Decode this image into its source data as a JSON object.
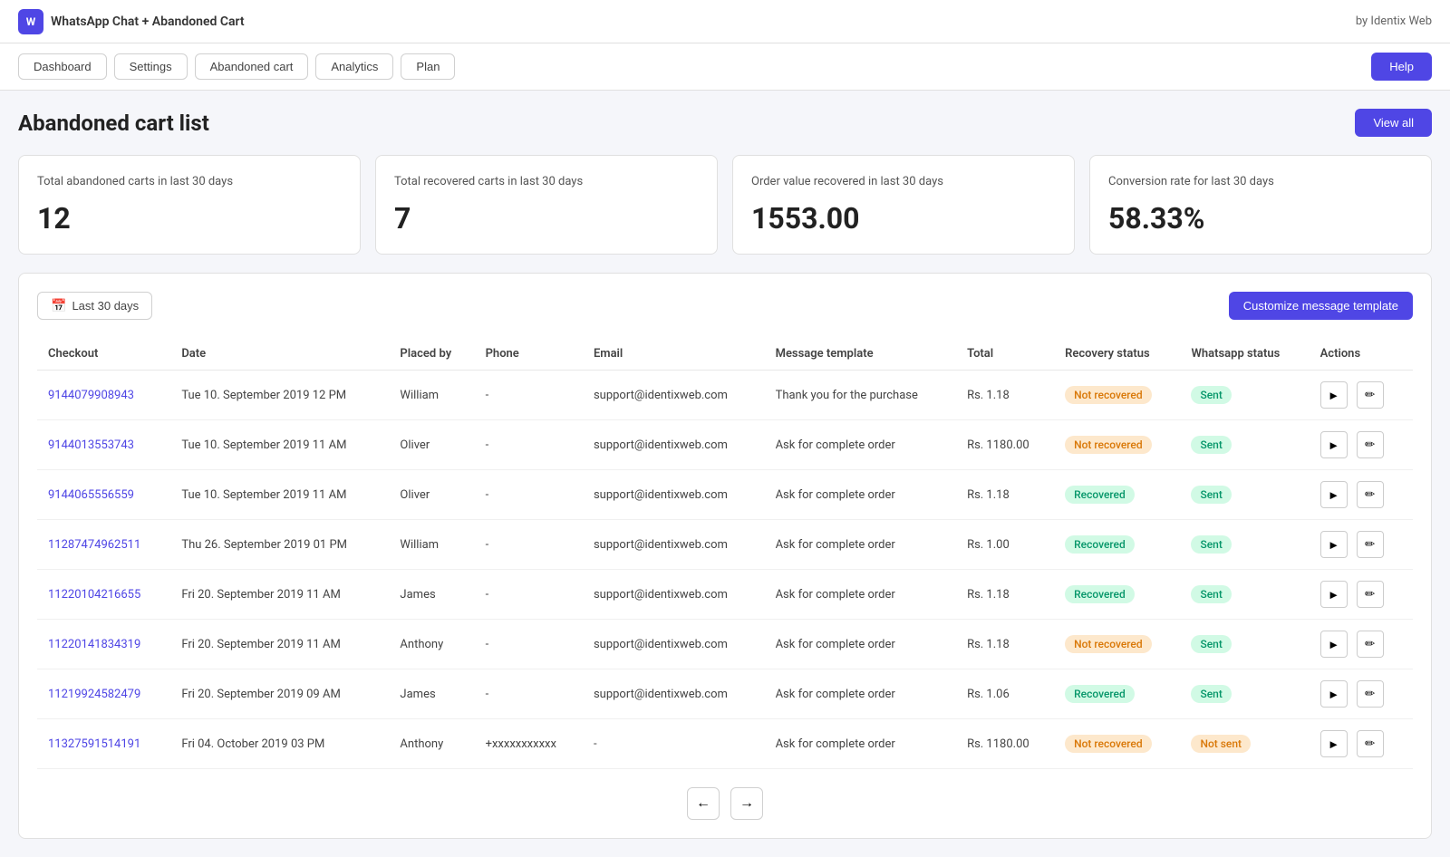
{
  "app": {
    "title": "WhatsApp Chat + Abandoned Cart",
    "brand": "by Identix Web",
    "icon_text": "W"
  },
  "nav": {
    "items": [
      "Dashboard",
      "Settings",
      "Abandoned cart",
      "Analytics",
      "Plan"
    ],
    "help_label": "Help"
  },
  "page": {
    "title": "Abandoned cart list",
    "view_all_label": "View all"
  },
  "stats": [
    {
      "label": "Total abandoned carts in last 30 days",
      "value": "12"
    },
    {
      "label": "Total recovered carts in last 30 days",
      "value": "7"
    },
    {
      "label": "Order value recovered in last 30 days",
      "value": "1553.00"
    },
    {
      "label": "Conversion rate for last 30 days",
      "value": "58.33%"
    }
  ],
  "table": {
    "date_filter_label": "Last 30 days",
    "customize_btn_label": "Customize message template",
    "columns": [
      "Checkout",
      "Date",
      "Placed by",
      "Phone",
      "Email",
      "Message template",
      "Total",
      "Recovery status",
      "Whatsapp status",
      "Actions"
    ],
    "rows": [
      {
        "checkout": "9144079908943",
        "date": "Tue 10. September 2019 12 PM",
        "placed_by": "William",
        "phone": "-",
        "email": "support@identixweb.com",
        "message_template": "Thank you for the purchase",
        "total": "Rs. 1.18",
        "recovery_status": "Not recovered",
        "recovery_status_type": "not-recovered",
        "whatsapp_status": "Sent",
        "whatsapp_status_type": "sent"
      },
      {
        "checkout": "9144013553743",
        "date": "Tue 10. September 2019 11 AM",
        "placed_by": "Oliver",
        "phone": "-",
        "email": "support@identixweb.com",
        "message_template": "Ask for complete order",
        "total": "Rs. 1180.00",
        "recovery_status": "Not recovered",
        "recovery_status_type": "not-recovered",
        "whatsapp_status": "Sent",
        "whatsapp_status_type": "sent"
      },
      {
        "checkout": "9144065556559",
        "date": "Tue 10. September 2019 11 AM",
        "placed_by": "Oliver",
        "phone": "-",
        "email": "support@identixweb.com",
        "message_template": "Ask for complete order",
        "total": "Rs. 1.18",
        "recovery_status": "Recovered",
        "recovery_status_type": "recovered",
        "whatsapp_status": "Sent",
        "whatsapp_status_type": "sent"
      },
      {
        "checkout": "11287474962511",
        "date": "Thu 26. September 2019 01 PM",
        "placed_by": "William",
        "phone": "-",
        "email": "support@identixweb.com",
        "message_template": "Ask for complete order",
        "total": "Rs. 1.00",
        "recovery_status": "Recovered",
        "recovery_status_type": "recovered",
        "whatsapp_status": "Sent",
        "whatsapp_status_type": "sent"
      },
      {
        "checkout": "11220104216655",
        "date": "Fri 20. September 2019 11 AM",
        "placed_by": "James",
        "phone": "-",
        "email": "support@identixweb.com",
        "message_template": "Ask for complete order",
        "total": "Rs. 1.18",
        "recovery_status": "Recovered",
        "recovery_status_type": "recovered",
        "whatsapp_status": "Sent",
        "whatsapp_status_type": "sent"
      },
      {
        "checkout": "11220141834319",
        "date": "Fri 20. September 2019 11 AM",
        "placed_by": "Anthony",
        "phone": "-",
        "email": "support@identixweb.com",
        "message_template": "Ask for complete order",
        "total": "Rs. 1.18",
        "recovery_status": "Not recovered",
        "recovery_status_type": "not-recovered",
        "whatsapp_status": "Sent",
        "whatsapp_status_type": "sent"
      },
      {
        "checkout": "11219924582479",
        "date": "Fri 20. September 2019 09 AM",
        "placed_by": "James",
        "phone": "-",
        "email": "support@identixweb.com",
        "message_template": "Ask for complete order",
        "total": "Rs. 1.06",
        "recovery_status": "Recovered",
        "recovery_status_type": "recovered",
        "whatsapp_status": "Sent",
        "whatsapp_status_type": "sent"
      },
      {
        "checkout": "11327591514191",
        "date": "Fri 04. October 2019 03 PM",
        "placed_by": "Anthony",
        "phone": "+xxxxxxxxxxx",
        "email": "-",
        "message_template": "Ask for complete order",
        "total": "Rs. 1180.00",
        "recovery_status": "Not recovered",
        "recovery_status_type": "not-recovered",
        "whatsapp_status": "Not sent",
        "whatsapp_status_type": "not-sent"
      }
    ]
  },
  "pagination": {
    "prev_label": "←",
    "next_label": "→"
  }
}
